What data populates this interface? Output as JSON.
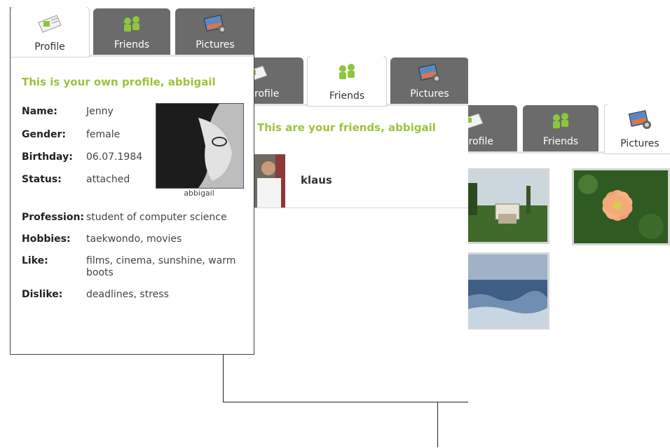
{
  "profile_screen": {
    "tabs": [
      {
        "label": "Profile"
      },
      {
        "label": "Friends"
      },
      {
        "label": "Pictures"
      }
    ],
    "heading": "This is your own profile, abbigail",
    "fields": [
      {
        "key": "Name:",
        "value": "Jenny"
      },
      {
        "key": "Gender:",
        "value": "female"
      },
      {
        "key": "Birthday:",
        "value": "06.07.1984"
      },
      {
        "key": "Status:",
        "value": "attached"
      },
      {
        "key": "Profession:",
        "value": "student of computer science"
      },
      {
        "key": "Hobbies:",
        "value": "taekwondo, movies"
      },
      {
        "key": "Like:",
        "value": "films, cinema, sunshine, warm boots"
      },
      {
        "key": "Dislike:",
        "value": "deadlines, stress"
      }
    ],
    "avatar_caption": "abbigail"
  },
  "friends_screen": {
    "tabs": [
      {
        "label": "rofile"
      },
      {
        "label": "Friends"
      },
      {
        "label": "Pictures"
      }
    ],
    "heading": "This are your friends, abbigail",
    "friends": [
      {
        "name": "klaus"
      }
    ]
  },
  "pictures_screen": {
    "tabs": [
      {
        "label": "rofile"
      },
      {
        "label": "Friends"
      },
      {
        "label": "Pictures"
      }
    ],
    "pictures": [
      {
        "subject": "garden"
      },
      {
        "subject": "flower"
      },
      {
        "subject": "sea"
      }
    ]
  },
  "colors": {
    "accent": "#9dc33b",
    "tab_inactive": "#6b6b6b"
  }
}
